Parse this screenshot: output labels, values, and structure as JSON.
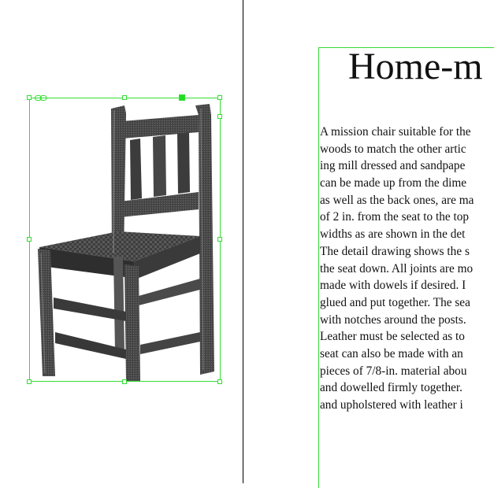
{
  "article": {
    "headline": "Home-m",
    "lines": [
      "A mission chair suitable for the",
      "woods to match the other artic",
      "ing mill dressed and sandpape",
      "can be made up from the dime",
      "as well as the back ones, are ma",
      "of 2 in. from the seat to the top",
      "widths as are shown in the det",
      "The detail drawing shows the s",
      "the seat down. All joints are mo",
      "made with dowels if desired. I",
      "glued and put together. The sea",
      "with notches around the posts.",
      "Leather must be selected as to",
      "seat can also be made with an",
      "pieces of 7/8-in. material abou",
      "and dowelled firmly together.",
      "and upholstered with leather i"
    ]
  },
  "image": {
    "icon": "chair-illustration"
  },
  "colors": {
    "selection": "#33dd33",
    "gutter": "#000000",
    "ink": "#111111"
  }
}
